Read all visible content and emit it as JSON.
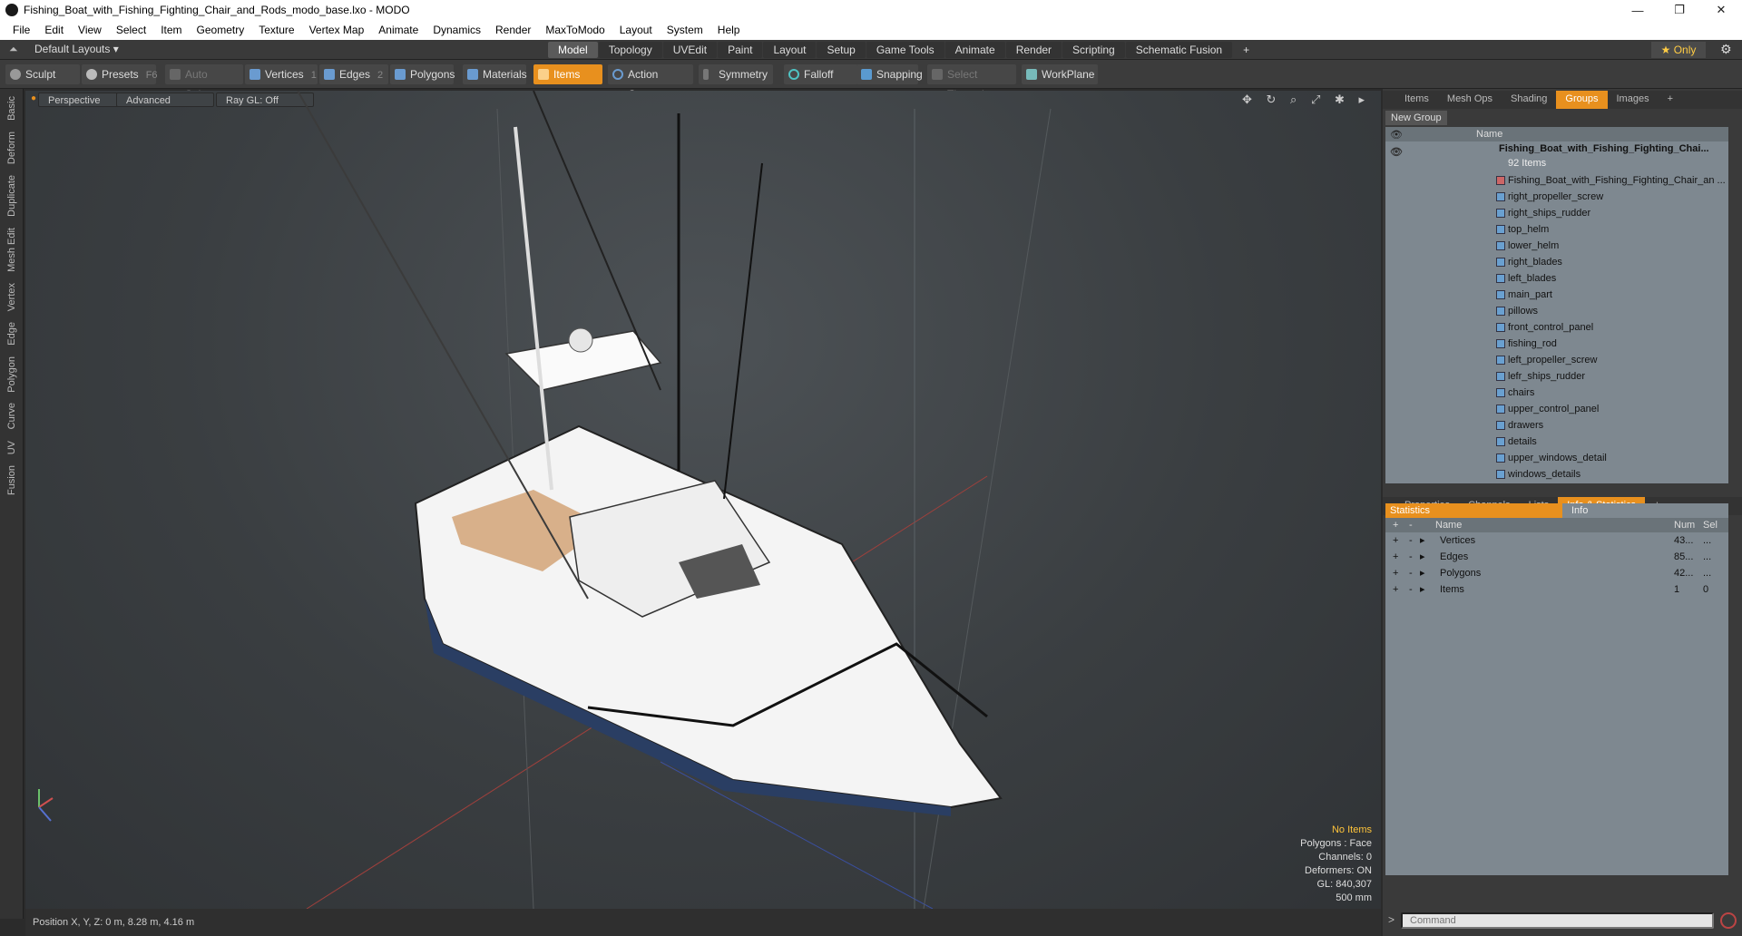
{
  "window": {
    "title": "Fishing_Boat_with_Fishing_Fighting_Chair_and_Rods_modo_base.lxo - MODO",
    "controls": [
      "—",
      "❐",
      "✕"
    ]
  },
  "menu": [
    "File",
    "Edit",
    "View",
    "Select",
    "Item",
    "Geometry",
    "Texture",
    "Vertex Map",
    "Animate",
    "Dynamics",
    "Render",
    "MaxToModo",
    "Layout",
    "System",
    "Help"
  ],
  "layoutbar": {
    "layouts_label": "Default Layouts ▾",
    "tabs": [
      "Model",
      "Topology",
      "UVEdit",
      "Paint",
      "Layout",
      "Setup",
      "Game Tools",
      "Animate",
      "Render",
      "Scripting",
      "Schematic Fusion",
      "+"
    ],
    "active_tab": "Model",
    "only_label": "★  Only"
  },
  "toolbar": {
    "sculpt": "Sculpt",
    "presets": "Presets",
    "presets_key": "F6",
    "auto_select": "Auto Select",
    "vertices": "Vertices",
    "vertices_key": "1",
    "edges": "Edges",
    "edges_key": "2",
    "polygons": "Polygons",
    "materials": "Materials",
    "items": "Items",
    "action_center": "Action Center",
    "symmetry": "Symmetry",
    "falloff": "Falloff",
    "snapping": "Snapping",
    "select_through": "Select Through",
    "workplane": "WorkPlane"
  },
  "left_strip": [
    "Basic",
    "Deform",
    "Duplicate",
    "Mesh Edit",
    "Vertex",
    "Edge",
    "Polygon",
    "Curve",
    "UV",
    "Fusion"
  ],
  "viewport": {
    "perspective": "Perspective",
    "advanced": "Advanced",
    "raygl": "Ray GL: Off",
    "icons": "✥ ↻ ⌕ ⤢ ✱ ▸",
    "info": {
      "no_items": "No Items",
      "polygons": "Polygons : Face",
      "channels": "Channels: 0",
      "deformers": "Deformers: ON",
      "gl": "GL: 840,307",
      "scale": "500 mm"
    }
  },
  "status": "Position X, Y, Z:   0 m, 8.28 m, 4.16 m",
  "groups_panel": {
    "tabs": [
      "Items",
      "Mesh Ops",
      "Shading",
      "Groups",
      "Images",
      "+"
    ],
    "active_tab": "Groups",
    "new_group": "New Group",
    "column_name": "Name",
    "root_name": "Fishing_Boat_with_Fishing_Fighting_Chai...",
    "root_sub": "92 Items",
    "items": [
      "Fishing_Boat_with_Fishing_Fighting_Chair_an ...",
      "right_propeller_screw",
      "right_ships_rudder",
      "top_helm",
      "lower_helm",
      "right_blades",
      "left_blades",
      "main_part",
      "pillows",
      "front_control_panel",
      "fishing_rod",
      "left_propeller_screw",
      "lefr_ships_rudder",
      "chairs",
      "upper_control_panel",
      "drawers",
      "details",
      "upper_windows_detail",
      "windows_details"
    ]
  },
  "stats_panel": {
    "tabs": [
      "Properties",
      "Channels",
      "Lists",
      "Info & Statistics",
      "+"
    ],
    "active_tab": "Info & Statistics",
    "subtab_statistics": "Statistics",
    "subtab_info": "Info",
    "col_name": "Name",
    "col_num": "Num",
    "col_sel": "Sel",
    "rows": [
      {
        "name": "Vertices",
        "num": "43...",
        "sel": "..."
      },
      {
        "name": "Edges",
        "num": "85...",
        "sel": "..."
      },
      {
        "name": "Polygons",
        "num": "42...",
        "sel": "..."
      },
      {
        "name": "Items",
        "num": "1",
        "sel": "0"
      }
    ]
  },
  "command_placeholder": "Command"
}
